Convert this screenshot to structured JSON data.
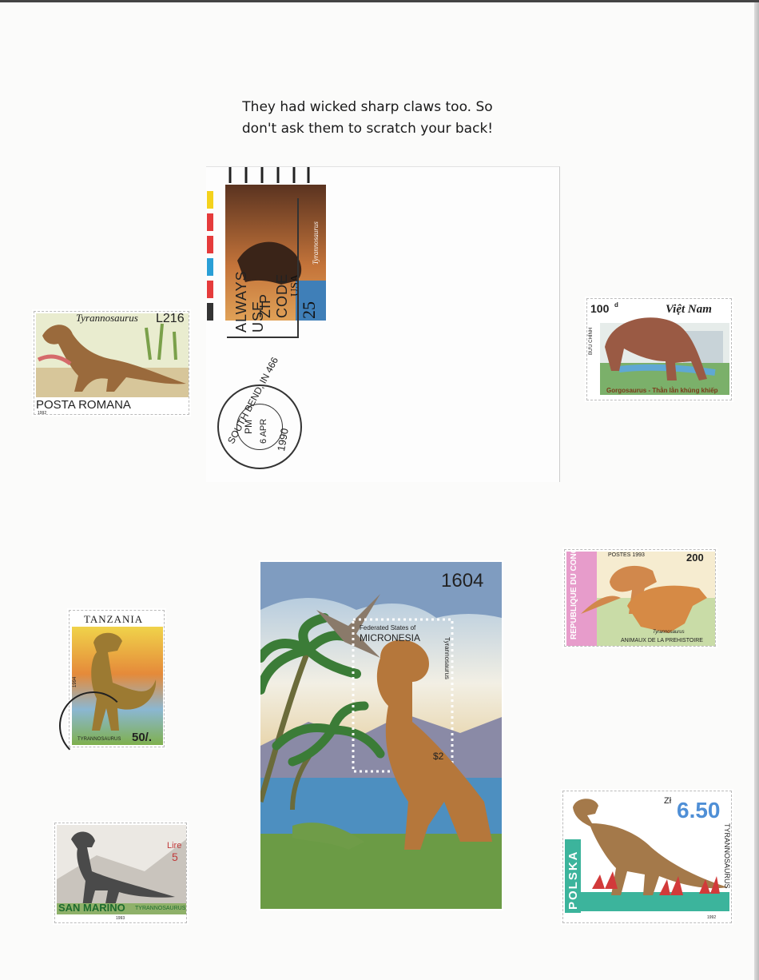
{
  "caption": {
    "line1": "They had wicked sharp claws too. So",
    "line2": "don't ask them to scratch your back!"
  },
  "stamps": {
    "romania": {
      "species": "Tyrannosaurus",
      "value": "L216",
      "country": "POSTA ROMANA",
      "year": "1992"
    },
    "usa": {
      "species": "Tyrannosaurus",
      "value": "25",
      "country": "USA"
    },
    "postmark": {
      "line1": "ALWAYS USE",
      "line2": "ZIP CODE",
      "city": "SOUTH BEND, IN 466",
      "time": "PM",
      "date": "6 APR",
      "year": "1990"
    },
    "vietnam": {
      "value": "100",
      "unit": "d",
      "country": "Việt Nam",
      "side": "BƯU CHÍNH",
      "caption": "Gorgosaurus - Thằn lằn khủng khiếp"
    },
    "congo": {
      "country": "REPUBLIQUE DU CONGO",
      "value": "200",
      "year": "POSTES 1993",
      "caption": "ANIMAUX DE LA PREHISTOIRE",
      "species": "Tyrannosaurus"
    },
    "tanzania": {
      "country": "TANZANIA",
      "value": "50/.",
      "year": "1994",
      "species": "TYRANNOSAURUS"
    },
    "micronesia": {
      "number": "1604",
      "country_line1": "Federated States of",
      "country_line2": "MICRONESIA",
      "species": "Tyrannosaurus",
      "value": "$2"
    },
    "sanmarino": {
      "unit": "Lire",
      "value": "5",
      "country": "SAN MARINO",
      "species": "TYRANNOSAURUS",
      "year": "1993"
    },
    "polska": {
      "currency": "Zł",
      "value": "6.50",
      "country": "POLSKA",
      "species": "TYRANNOSAURUS",
      "year": "1992"
    }
  },
  "colors": {
    "ink": "#1a1a1a",
    "dino_brown": "#9a6a3c",
    "sky_blue": "#a9c7e2",
    "grass_green": "#5f9e4a",
    "polska_teal": "#3cb49c",
    "polska_blue": "#4f8fd6"
  }
}
